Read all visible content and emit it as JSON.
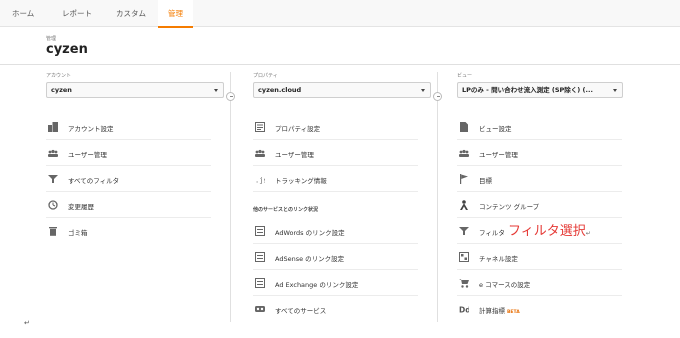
{
  "tabs": [
    {
      "label": "ホーム",
      "active": false
    },
    {
      "label": "レポート",
      "active": false
    },
    {
      "label": "カスタム",
      "active": false
    },
    {
      "label": "管理",
      "active": true
    }
  ],
  "header": {
    "crumb": "管理",
    "account_name": "cyzen"
  },
  "account": {
    "label": "アカウント",
    "selected": "cyzen",
    "items": [
      {
        "label": "アカウント設定",
        "icon": "building-icon"
      },
      {
        "label": "ユーザー管理",
        "icon": "users-icon"
      },
      {
        "label": "すべてのフィルタ",
        "icon": "filter-icon"
      },
      {
        "label": "変更履歴",
        "icon": "history-icon"
      },
      {
        "label": "ゴミ箱",
        "icon": "trash-icon"
      }
    ]
  },
  "property": {
    "label": "プロパティ",
    "selected": "cyzen.cloud",
    "items": [
      {
        "label": "プロパティ設定",
        "icon": "property-settings-icon"
      },
      {
        "label": "ユーザー管理",
        "icon": "users-icon"
      },
      {
        "label": "トラッキング情報",
        "icon": "js-icon"
      }
    ],
    "section_title": "他のサービスとのリンク状況",
    "link_items": [
      {
        "label": "AdWords のリンク設定",
        "icon": "adwords-icon"
      },
      {
        "label": "AdSense のリンク設定",
        "icon": "adsense-icon"
      },
      {
        "label": "Ad Exchange のリンク設定",
        "icon": "ad-exchange-icon"
      },
      {
        "label": "すべてのサービス",
        "icon": "link-icon"
      }
    ]
  },
  "view": {
    "label": "ビュー",
    "selected": "LPのみ - 問い合わせ流入測定 (SP除く) (...",
    "items": [
      {
        "label": "ビュー設定",
        "icon": "document-icon"
      },
      {
        "label": "ユーザー管理",
        "icon": "users-icon"
      },
      {
        "label": "目標",
        "icon": "flag-icon"
      },
      {
        "label": "コンテンツ グループ",
        "icon": "person-icon"
      },
      {
        "label": "フィルタ",
        "icon": "filter-icon"
      },
      {
        "label": "チャネル設定",
        "icon": "channel-icon"
      },
      {
        "label": "e コマースの設定",
        "icon": "cart-icon"
      },
      {
        "label": "計算指標",
        "icon": "dd-icon",
        "badge": "BETA"
      }
    ]
  },
  "annotation": {
    "text": "フィルタ選択",
    "mark": "↵"
  },
  "footer_mark": "↵"
}
